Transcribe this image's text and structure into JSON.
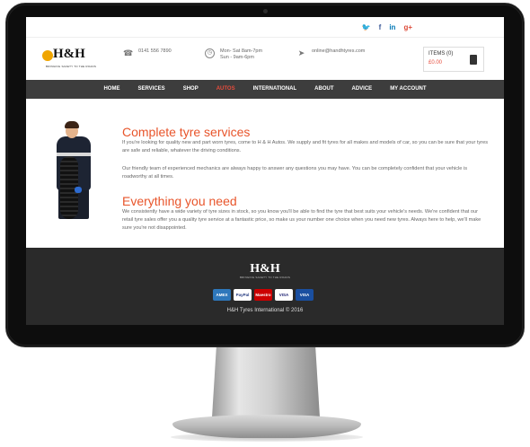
{
  "social": {
    "items": [
      "twitter-icon",
      "facebook-icon",
      "linkedin-icon",
      "google-plus-icon"
    ],
    "glyphs": [
      "🐦",
      "f",
      "in",
      "g+"
    ]
  },
  "logo": {
    "text": "H&H",
    "tagline": "BRINGING SAFETY TO THE ROADS"
  },
  "header": {
    "phone": "0141 556 7890",
    "hours_line1": "Mon- Sat 8am-7pm",
    "hours_line2": "Sun - 9am-6pm",
    "email": "online@handhtyres.com"
  },
  "cart": {
    "items_label": "ITEMS",
    "items_count": "(0)",
    "price": "£0.00"
  },
  "nav": {
    "items": [
      "HOME",
      "SERVICES",
      "SHOP",
      "AUTOS",
      "INTERNATIONAL",
      "ABOUT",
      "ADVICE",
      "MY ACCOUNT"
    ],
    "active": "AUTOS"
  },
  "content": {
    "heading1": "Complete tyre services",
    "para1": "If you're looking for quality new and part worn tyres, come to H & H Autos. We supply and fit tyres for all makes and models of car, so you can be sure that your tyres are safe and reliable, whatever the driving conditions.",
    "para2": "Our friendly team of experienced mechanics are always happy to answer any questions you may have. You can be completely confident that your vehicle is roadworthy at all times.",
    "heading2": "Everything you need",
    "para3": "We consistently have a wide variety of tyre sizes in stock, so you know you'll be able to find the tyre that best suits your vehicle's needs. We're confident that our retail tyre sales offer you a quality tyre service at a fantastic price, so make us your number one choice when you need new tyres. Always here to help, we'll make sure you're not disappointed."
  },
  "footer": {
    "logo_text": "H&H",
    "logo_tagline": "BRINGING SAFETY TO THE ROADS",
    "payments": [
      "AMEX",
      "PayPal",
      "Maestro",
      "VISA",
      "VISA"
    ],
    "copyright": "H&H Tyres International © 2016"
  },
  "colors": {
    "accent": "#e8552b",
    "nav_bg": "#3d3d3d",
    "footer_bg": "#2a2a2a"
  }
}
